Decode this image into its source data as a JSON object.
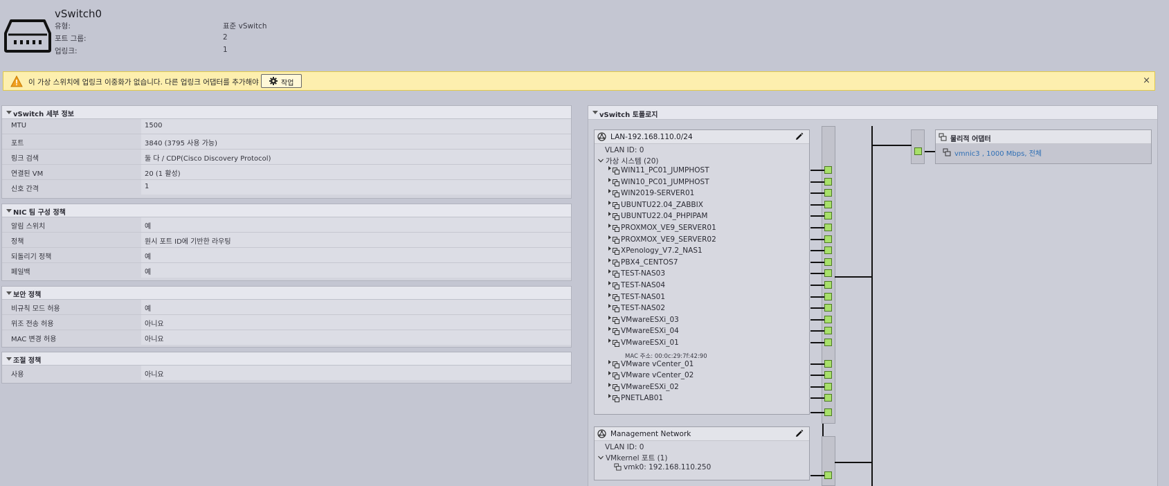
{
  "header": {
    "title": "vSwitch0",
    "rows": [
      {
        "key": "유형:",
        "value": "표준 vSwitch"
      },
      {
        "key": "포트 그룹:",
        "value": "2"
      },
      {
        "key": "업링크:",
        "value": "1"
      }
    ]
  },
  "warning": {
    "text": "이 가상 스위치에 업링크 이중화가 없습니다. 다른 업링크 어댑터를 추가해야 합니다.",
    "action_label": "작업",
    "close_label": "×"
  },
  "details": {
    "title": "vSwitch 세부 정보",
    "rows": [
      {
        "key": "MTU",
        "value": "1500"
      },
      {
        "key": "포트",
        "value": "3840 (3795 사용 가능)"
      },
      {
        "key": "링크 검색",
        "value": "둘 다 / CDP(Cisco Discovery Protocol)"
      },
      {
        "key": "연결된 VM",
        "value": "20 (1 활성)"
      },
      {
        "key": "신호 간격",
        "value": "1"
      }
    ]
  },
  "nic_teaming": {
    "title": "NIC 팀 구성 정책",
    "rows": [
      {
        "key": "알림 스위치",
        "value": "예"
      },
      {
        "key": "정책",
        "value": "원시 포트 ID에 기반한 라우팅"
      },
      {
        "key": "되돌리기 정책",
        "value": "예"
      },
      {
        "key": "페일백",
        "value": "예"
      }
    ]
  },
  "security": {
    "title": "보안 정책",
    "rows": [
      {
        "key": "비규칙 모드 허용",
        "value": "예"
      },
      {
        "key": "위조 전송 허용",
        "value": "아니요"
      },
      {
        "key": "MAC 변경 허용",
        "value": "아니요"
      }
    ]
  },
  "shaping": {
    "title": "조절 정책",
    "rows": [
      {
        "key": "사용",
        "value": "아니요"
      }
    ]
  },
  "topology": {
    "title": "vSwitch 토폴로지",
    "lan": {
      "name": "LAN-192.168.110.0/24",
      "vlan": "VLAN ID: 0",
      "vm_header": "가상 시스템 (20)",
      "vms": [
        "WIN11_PC01_JUMPHOST",
        "WIN10_PC01_JUMPHOST",
        "WIN2019-SERVER01",
        "UBUNTU22.04_ZABBIX",
        "UBUNTU22.04_PHPIPAM",
        "PROXMOX_VE9_SERVER01",
        "PROXMOX_VE9_SERVER02",
        "XPenology_V7.2_NAS1",
        "PBX4_CENTOS7",
        "TEST-NAS03",
        "TEST-NAS04",
        "TEST-NAS01",
        "TEST-NAS02",
        "VMwareESXi_03",
        "VMwareESXi_04",
        "VMwareESXi_01",
        "VMware vCenter_01",
        "VMware vCenter_02",
        "VMwareESXi_02",
        "PNETLAB01"
      ],
      "mac_note": "MAC 주소: 00:0c:29:7f:42:90"
    },
    "mgmt": {
      "name": "Management Network",
      "vlan": "VLAN ID: 0",
      "vmk_header": "VMkernel 포트 (1)",
      "vmk": "vmk0: 192.168.110.250"
    },
    "physical": {
      "title": "물리적 어댑터",
      "nic": "vmnic3 , 1000 Mbps, 전체"
    }
  },
  "colors": {
    "background": "#c4c6d2",
    "warning_bg": "#fdefae",
    "port_green": "#a8e06a",
    "link_blue": "#2f6fb5"
  }
}
